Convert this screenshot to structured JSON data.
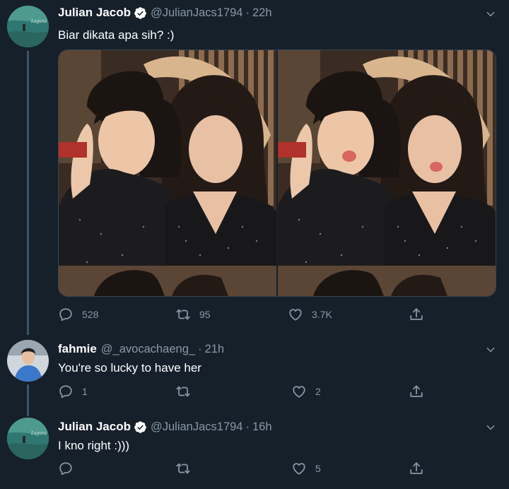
{
  "thread": [
    {
      "name": "Julian Jacob",
      "handle": "@JulianJacs1794",
      "dot": "·",
      "time": "22h",
      "text": "Biar dikata apa sih? :)",
      "verified": true,
      "avatar_icon": "profile-photo-sea",
      "media_count": 2,
      "replies": "528",
      "retweets": "95",
      "likes": "3.7K"
    },
    {
      "name": "fahmie",
      "handle": "@_avocachaeng_",
      "dot": "·",
      "time": "21h",
      "text": "You're so lucky to have her",
      "verified": false,
      "avatar_icon": "profile-photo-person",
      "replies": "1",
      "retweets": "",
      "likes": "2"
    },
    {
      "name": "Julian Jacob",
      "handle": "@JulianJacs1794",
      "dot": "·",
      "time": "16h",
      "text": "I kno right :)))",
      "verified": true,
      "avatar_icon": "profile-photo-sea",
      "replies": "",
      "retweets": "",
      "likes": "5"
    }
  ],
  "colors": {
    "background": "#15202b",
    "secondary_text": "#8899a6",
    "verified": "#ffffff",
    "thread_line": "#3d5466",
    "border": "#38444d"
  }
}
